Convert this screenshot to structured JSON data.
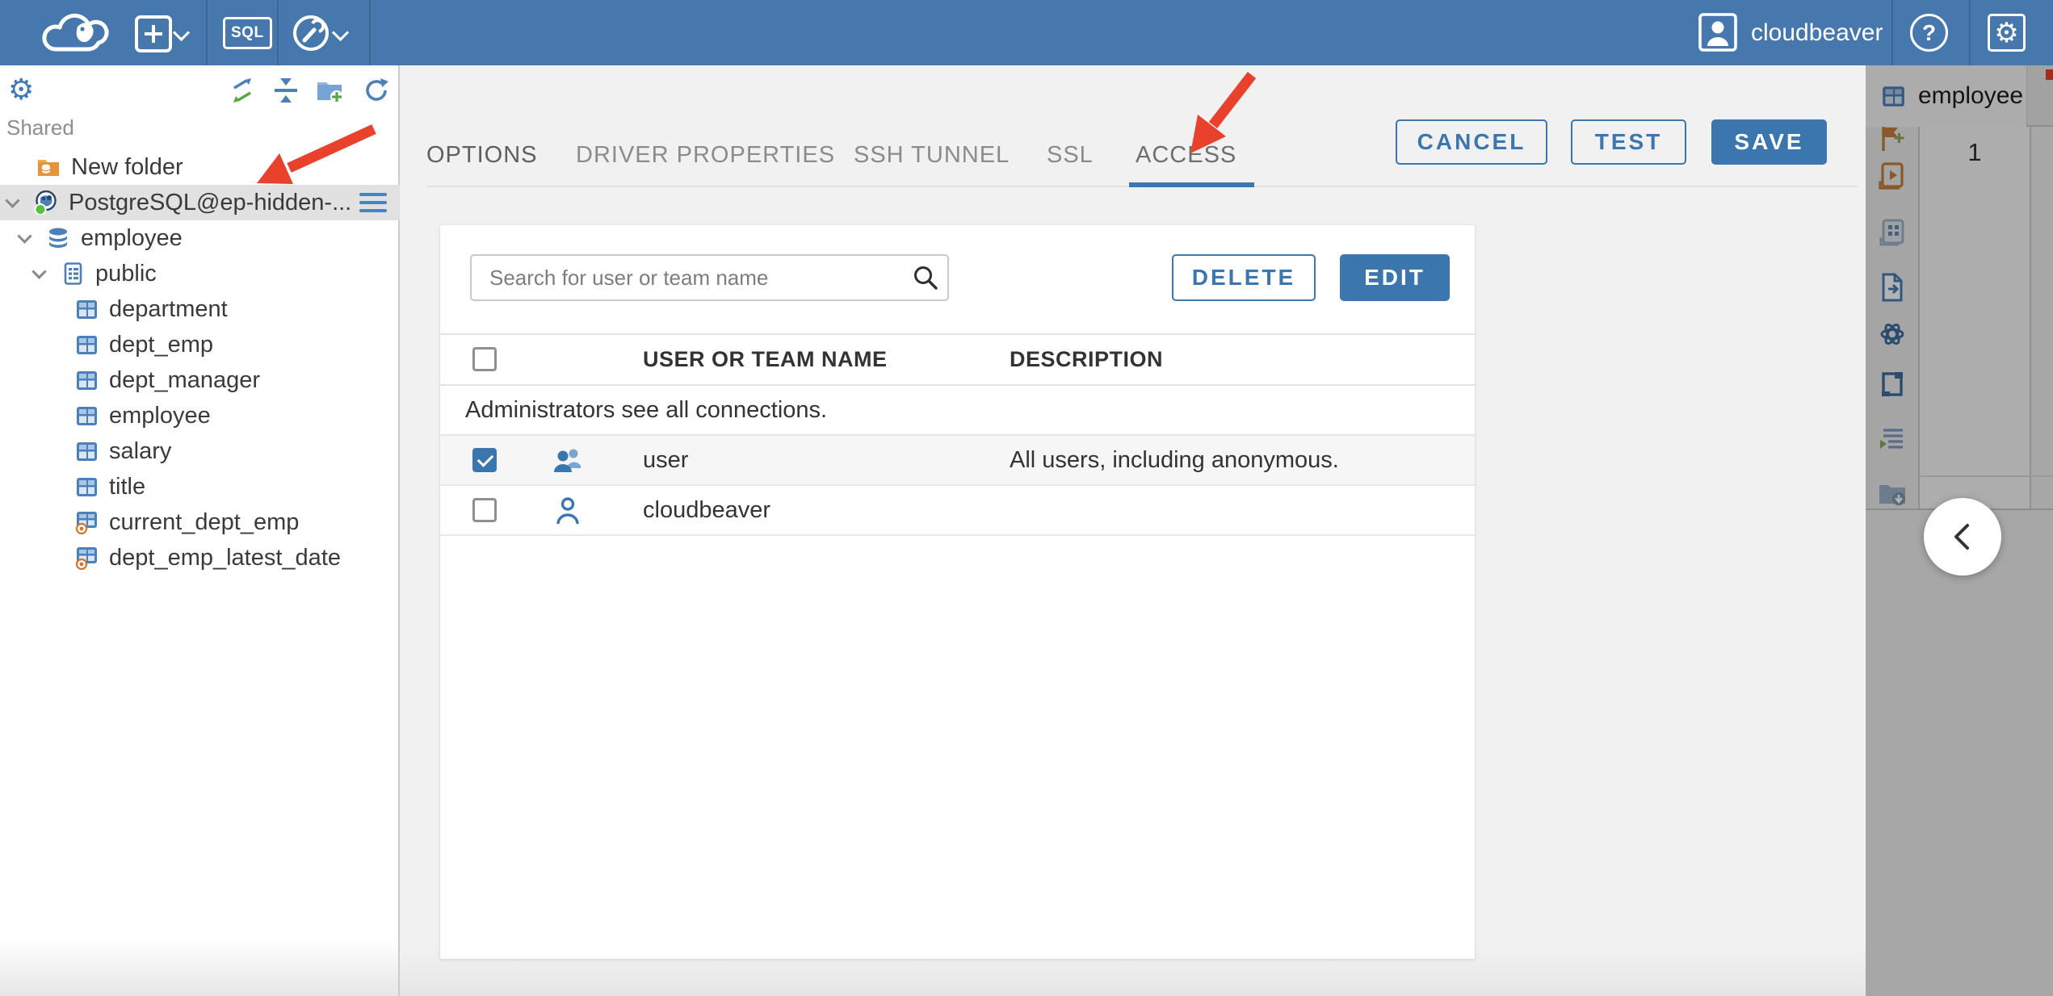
{
  "topbar": {
    "user_name": "cloudbeaver",
    "sql_button_label": "SQL",
    "help_label": "?"
  },
  "sidebar": {
    "section_label": "Shared",
    "tree": [
      {
        "label": "New folder",
        "icon": "folder-database-icon",
        "indent": 45,
        "chevron": false,
        "selected": false
      },
      {
        "label": "PostgreSQL@ep-hidden-...",
        "icon": "postgres-icon",
        "indent": 9,
        "chevron": true,
        "selected": true,
        "menu": true
      },
      {
        "label": "employee",
        "icon": "database-icon",
        "indent": 24,
        "chevron": true
      },
      {
        "label": "public",
        "icon": "schema-icon",
        "indent": 42,
        "chevron": true
      },
      {
        "label": "department",
        "icon": "table-icon",
        "indent": 92
      },
      {
        "label": "dept_emp",
        "icon": "table-icon",
        "indent": 92
      },
      {
        "label": "dept_manager",
        "icon": "table-icon",
        "indent": 92
      },
      {
        "label": "employee",
        "icon": "table-icon",
        "indent": 92
      },
      {
        "label": "salary",
        "icon": "table-icon",
        "indent": 92
      },
      {
        "label": "title",
        "icon": "table-icon",
        "indent": 92
      },
      {
        "label": "current_dept_emp",
        "icon": "view-icon",
        "indent": 92
      },
      {
        "label": "dept_emp_latest_date",
        "icon": "view-icon",
        "indent": 92
      }
    ]
  },
  "dialog": {
    "tabs": [
      {
        "label": "OPTIONS",
        "active": false
      },
      {
        "label": "DRIVER PROPERTIES",
        "active": false
      },
      {
        "label": "SSH TUNNEL",
        "active": false
      },
      {
        "label": "SSL",
        "active": false
      },
      {
        "label": "ACCESS",
        "active": true
      }
    ],
    "cancel_label": "CANCEL",
    "test_label": "TEST",
    "save_label": "SAVE",
    "search_placeholder": "Search for user or team name",
    "delete_label": "DELETE",
    "edit_label": "EDIT",
    "table": {
      "col_name": "USER OR TEAM NAME",
      "col_description": "DESCRIPTION",
      "notice": "Administrators see all connections.",
      "rows": [
        {
          "name": "user",
          "description": "All users, including anonymous.",
          "checked": true,
          "icon": "team-icon"
        },
        {
          "name": "cloudbeaver",
          "description": "",
          "checked": false,
          "icon": "user-icon"
        }
      ]
    }
  },
  "right_panel": {
    "tab_label": "employee",
    "row_number": "1"
  },
  "colors": {
    "topbar_blue": "#4678ae",
    "accent_blue": "#3b76ae",
    "arrow_red": "#e8412c",
    "selection_gray": "#e1e1e1"
  }
}
